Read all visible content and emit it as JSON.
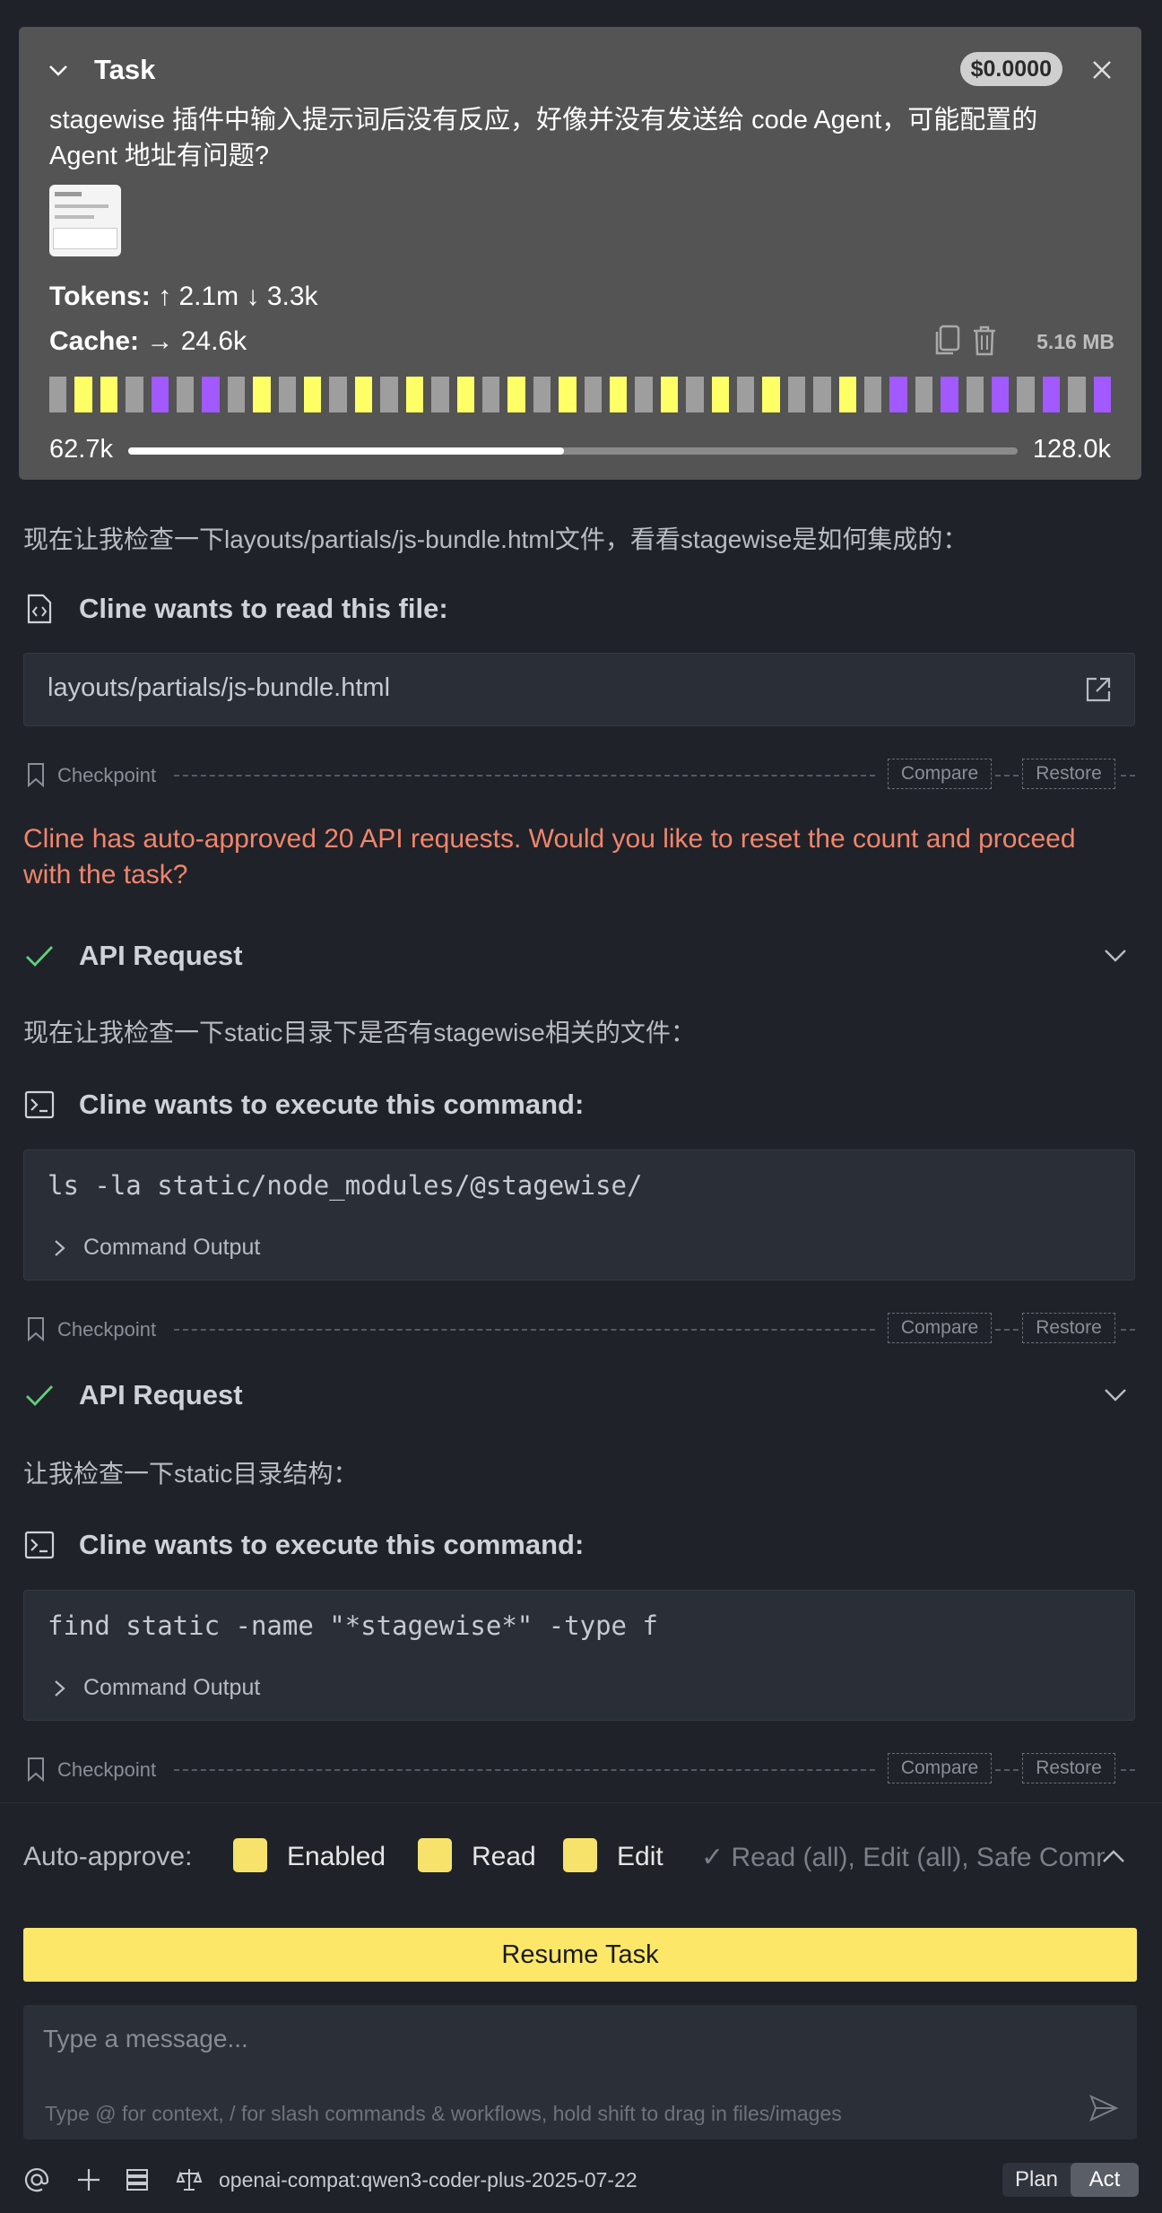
{
  "task": {
    "title": "Task",
    "cost": "$0.0000",
    "text": "stagewise 插件中输入提示词后没有反应，好像并没有发送给 code Agent，可能配置的 Agent 地址有问题?",
    "tokens_label": "Tokens:",
    "tokens_up": "↑ 2.1m",
    "tokens_down": "↓ 3.3k",
    "cache_label": "Cache:",
    "cache_value": "→ 24.6k",
    "size": "5.16 MB",
    "context_blocks": [
      "g",
      "y",
      "y",
      "g",
      "p",
      "g",
      "p",
      "g",
      "y",
      "g",
      "y",
      "g",
      "y",
      "g",
      "y",
      "g",
      "y",
      "g",
      "y",
      "g",
      "y",
      "g",
      "y",
      "g",
      "y",
      "g",
      "y",
      "g",
      "y",
      "g",
      "g",
      "y",
      "g",
      "p",
      "g",
      "p",
      "g",
      "p",
      "g",
      "p",
      "g",
      "p"
    ],
    "context_used": "62.7k",
    "context_max": "128.0k",
    "context_fraction": 0.49
  },
  "chat": {
    "msg1": "现在让我检查一下layouts/partials/js-bundle.html文件，看看stagewise是如何集成的：",
    "read_file_label": "Cline wants to read this file:",
    "file_path": "layouts/partials/js-bundle.html",
    "checkpoint_label": "Checkpoint",
    "compare_label": "Compare",
    "restore_label": "Restore",
    "auto_approve_warning": "Cline has auto-approved 20 API requests. Would you like to reset the count and proceed with the task?",
    "api_request_label": "API Request",
    "msg2": "现在让我检查一下static目录下是否有stagewise相关的文件：",
    "execute_label": "Cline wants to execute this command:",
    "cmd1": "ls -la static/node_modules/@stagewise/",
    "command_output_label": "Command Output",
    "msg3": "让我检查一下static目录结构：",
    "cmd2": "find static -name \"*stagewise*\" -type f"
  },
  "bottom": {
    "auto_approve_label": "Auto-approve:",
    "enabled_label": "Enabled",
    "read_label": "Read",
    "edit_label": "Edit",
    "auto_summary": "✓ Read (all), Edit (all), Safe Commands",
    "resume_label": "Resume Task",
    "input_placeholder": "Type a message...",
    "input_hint": "Type @ for context, / for slash commands & workflows, hold shift to drag in files/images",
    "model": "openai-compat:qwen3-coder-plus-2025-07-22",
    "plan_label": "Plan",
    "act_label": "Act"
  },
  "colors": {
    "accent_yellow": "#fde769",
    "warning": "#f2856b",
    "success": "#5fd07a",
    "purple": "#a259ff"
  }
}
